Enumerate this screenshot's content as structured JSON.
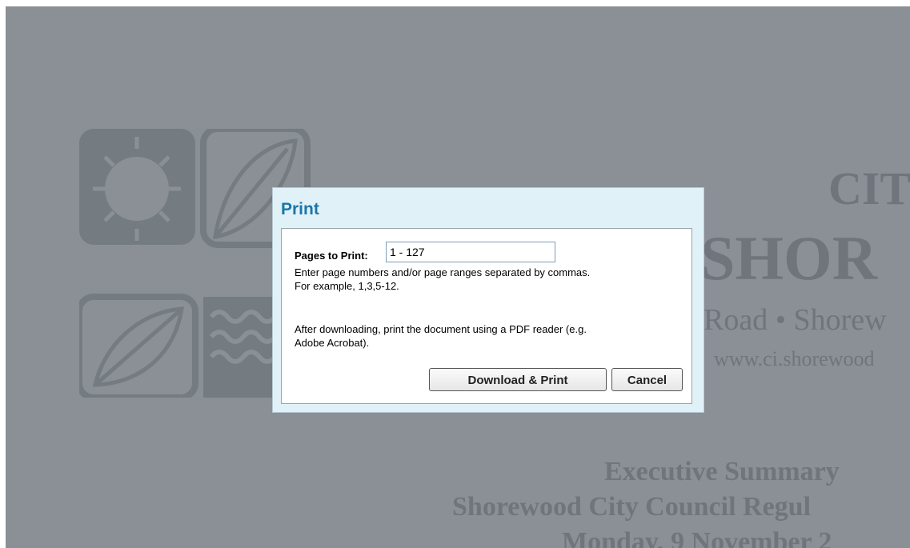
{
  "background_document": {
    "title_city": "CIT",
    "title_name": "SHOR",
    "address": "Road • Shorew",
    "website": "www.ci.shorewood",
    "summary": "Executive Summary",
    "council": "Shorewood City Council Regul",
    "meeting": "Monday, 9 November 2"
  },
  "print_dialog": {
    "title": "Print",
    "pages_label": "Pages to Print:",
    "pages_value": "1 - 127",
    "help_line_1": "Enter page numbers and/or page ranges separated by commas.",
    "help_line_2": "For example, 1,3,5-12.",
    "help_line_3": "After downloading, print the document using a PDF reader (e.g.",
    "help_line_4": "Adobe Acrobat).",
    "download_button": "Download & Print",
    "cancel_button": "Cancel"
  },
  "colors": {
    "overlay": "#8a9096",
    "dialog_background": "#e1f1f8",
    "title_color": "#1a76a8"
  },
  "icons": {
    "logo": "city-logo"
  }
}
